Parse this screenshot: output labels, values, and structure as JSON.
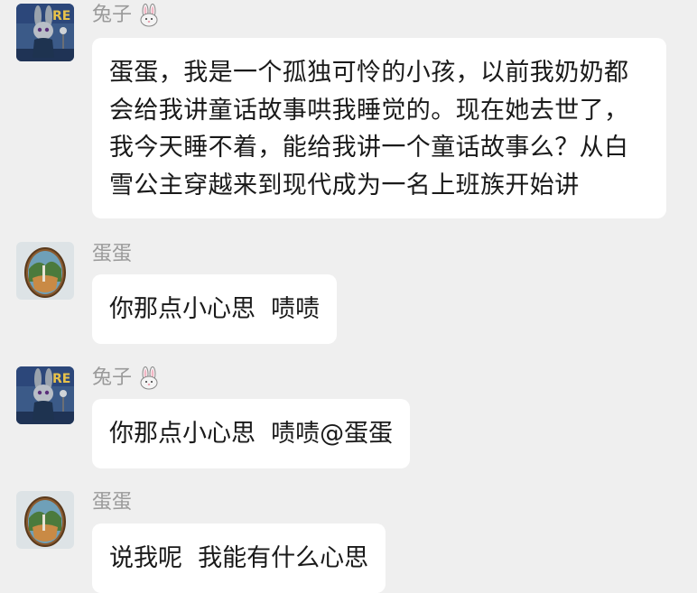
{
  "messages": [
    {
      "sender": "兔子",
      "avatar": "rabbit-avatar",
      "text": "蛋蛋，我是一个孤独可怜的小孩，以前我奶奶都会给我讲童话故事哄我睡觉的。现在她去世了，我今天睡不着，能给我讲一个童话故事么？从白雪公主穿越来到现代成为一名上班族开始讲"
    },
    {
      "sender": "蛋蛋",
      "avatar": "egg-avatar",
      "text": "你那点小心思  啧啧"
    },
    {
      "sender": "兔子",
      "avatar": "rabbit-avatar",
      "text": "你那点小心思  啧啧@蛋蛋"
    },
    {
      "sender": "蛋蛋",
      "avatar": "egg-avatar",
      "text": "说我呢  我能有什么心思"
    }
  ],
  "colors": {
    "background": "#efefef",
    "bubble": "#ffffff",
    "sender_name": "#9a9a9a",
    "text": "#1a1a1a"
  }
}
